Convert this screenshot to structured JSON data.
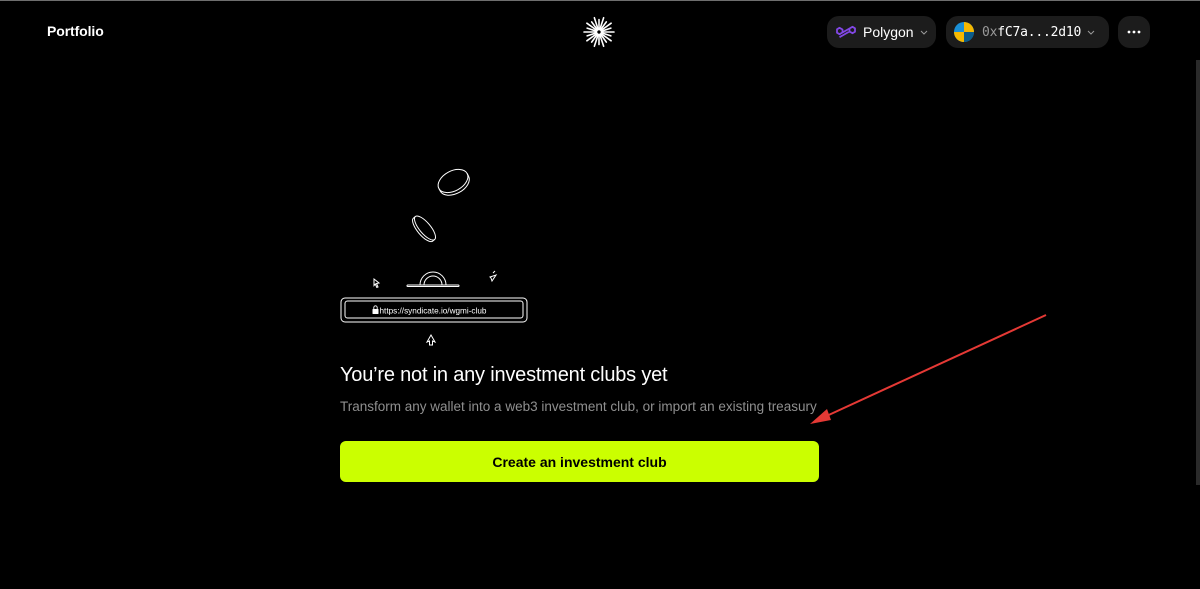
{
  "header": {
    "nav_link": "Portfolio",
    "logo_icon": "syndicate-starburst-icon",
    "network": {
      "label": "Polygon",
      "icon": "polygon-icon",
      "accent": "#8247e5"
    },
    "wallet": {
      "address_prefix": "0x",
      "address_rest": "fC7a...2d10",
      "icon": "wallet-avatar-icon"
    },
    "more_icon": "more-horizontal-icon"
  },
  "illustration": {
    "url": "https://syndicate.io/wgmi-club",
    "icons": [
      "coin-icon",
      "lock-icon",
      "cursor-icon",
      "sparkle-icon"
    ]
  },
  "empty_state": {
    "title": "You’re not in any investment clubs yet",
    "subtitle": "Transform any wallet into a web3 investment club, or import an existing treasury",
    "cta_label": "Create an investment club",
    "cta_color": "#cbff00"
  },
  "annotation": {
    "type": "arrow",
    "color": "#e53935"
  }
}
